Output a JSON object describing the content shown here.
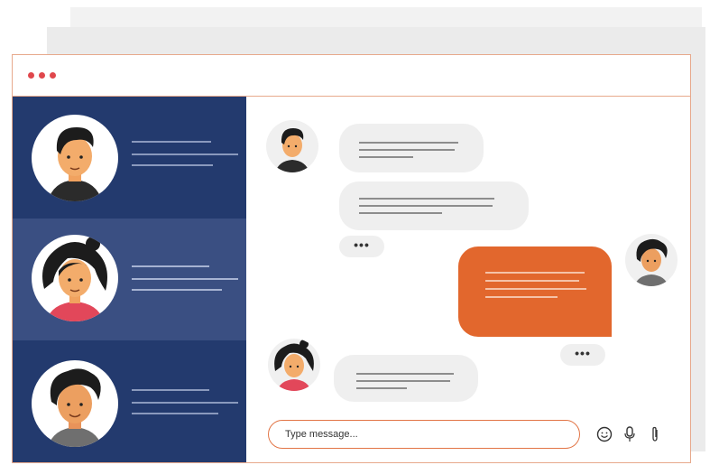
{
  "window": {
    "accent_color": "#e2672d",
    "dot_color": "#e0474c",
    "sidebar_color": "#233a6e",
    "active_color": "#3a4f82"
  },
  "contacts": [
    {
      "avatar": "man-short-hair-avatar",
      "active": false
    },
    {
      "avatar": "woman-curly-hair-avatar",
      "active": true
    },
    {
      "avatar": "man-curly-hair-avatar",
      "active": false
    }
  ],
  "conversation": {
    "typing_indicator": "•••",
    "messages": [
      {
        "from": "contact-1",
        "side": "left"
      },
      {
        "from": "contact-1",
        "side": "left"
      },
      {
        "from": "me",
        "side": "right"
      },
      {
        "from": "contact-2",
        "side": "left"
      }
    ]
  },
  "composer": {
    "placeholder": "Type message...",
    "value": "",
    "icons": [
      "emoji-icon",
      "microphone-icon",
      "attachment-icon"
    ]
  }
}
